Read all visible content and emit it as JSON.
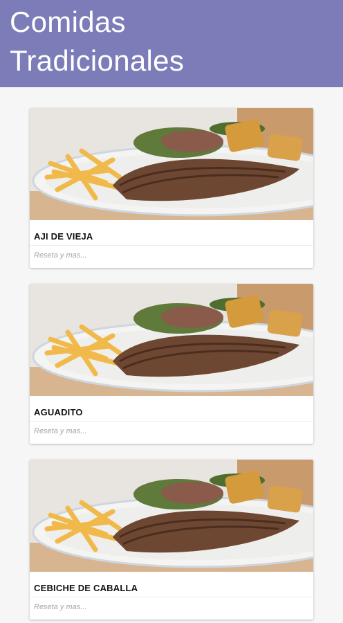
{
  "app_bar": {
    "title": "Comidas\nTradicionales",
    "color": "#7b7cb8"
  },
  "cards": [
    {
      "title": "AJI DE VIEJA",
      "subtitle": "Reseta y mas..."
    },
    {
      "title": "AGUADITO",
      "subtitle": "Reseta y mas..."
    },
    {
      "title": "CEBICHE DE CABALLA",
      "subtitle": "Reseta y mas..."
    }
  ]
}
